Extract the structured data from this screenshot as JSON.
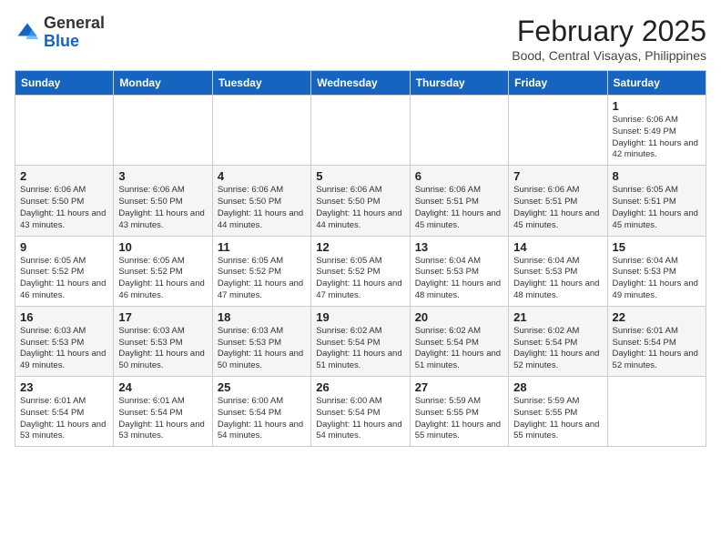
{
  "header": {
    "logo_general": "General",
    "logo_blue": "Blue",
    "month_year": "February 2025",
    "location": "Bood, Central Visayas, Philippines"
  },
  "weekdays": [
    "Sunday",
    "Monday",
    "Tuesday",
    "Wednesday",
    "Thursday",
    "Friday",
    "Saturday"
  ],
  "weeks": [
    [
      {
        "day": "",
        "info": ""
      },
      {
        "day": "",
        "info": ""
      },
      {
        "day": "",
        "info": ""
      },
      {
        "day": "",
        "info": ""
      },
      {
        "day": "",
        "info": ""
      },
      {
        "day": "",
        "info": ""
      },
      {
        "day": "1",
        "info": "Sunrise: 6:06 AM\nSunset: 5:49 PM\nDaylight: 11 hours and 42 minutes."
      }
    ],
    [
      {
        "day": "2",
        "info": "Sunrise: 6:06 AM\nSunset: 5:50 PM\nDaylight: 11 hours and 43 minutes."
      },
      {
        "day": "3",
        "info": "Sunrise: 6:06 AM\nSunset: 5:50 PM\nDaylight: 11 hours and 43 minutes."
      },
      {
        "day": "4",
        "info": "Sunrise: 6:06 AM\nSunset: 5:50 PM\nDaylight: 11 hours and 44 minutes."
      },
      {
        "day": "5",
        "info": "Sunrise: 6:06 AM\nSunset: 5:50 PM\nDaylight: 11 hours and 44 minutes."
      },
      {
        "day": "6",
        "info": "Sunrise: 6:06 AM\nSunset: 5:51 PM\nDaylight: 11 hours and 45 minutes."
      },
      {
        "day": "7",
        "info": "Sunrise: 6:06 AM\nSunset: 5:51 PM\nDaylight: 11 hours and 45 minutes."
      },
      {
        "day": "8",
        "info": "Sunrise: 6:05 AM\nSunset: 5:51 PM\nDaylight: 11 hours and 45 minutes."
      }
    ],
    [
      {
        "day": "9",
        "info": "Sunrise: 6:05 AM\nSunset: 5:52 PM\nDaylight: 11 hours and 46 minutes."
      },
      {
        "day": "10",
        "info": "Sunrise: 6:05 AM\nSunset: 5:52 PM\nDaylight: 11 hours and 46 minutes."
      },
      {
        "day": "11",
        "info": "Sunrise: 6:05 AM\nSunset: 5:52 PM\nDaylight: 11 hours and 47 minutes."
      },
      {
        "day": "12",
        "info": "Sunrise: 6:05 AM\nSunset: 5:52 PM\nDaylight: 11 hours and 47 minutes."
      },
      {
        "day": "13",
        "info": "Sunrise: 6:04 AM\nSunset: 5:53 PM\nDaylight: 11 hours and 48 minutes."
      },
      {
        "day": "14",
        "info": "Sunrise: 6:04 AM\nSunset: 5:53 PM\nDaylight: 11 hours and 48 minutes."
      },
      {
        "day": "15",
        "info": "Sunrise: 6:04 AM\nSunset: 5:53 PM\nDaylight: 11 hours and 49 minutes."
      }
    ],
    [
      {
        "day": "16",
        "info": "Sunrise: 6:03 AM\nSunset: 5:53 PM\nDaylight: 11 hours and 49 minutes."
      },
      {
        "day": "17",
        "info": "Sunrise: 6:03 AM\nSunset: 5:53 PM\nDaylight: 11 hours and 50 minutes."
      },
      {
        "day": "18",
        "info": "Sunrise: 6:03 AM\nSunset: 5:53 PM\nDaylight: 11 hours and 50 minutes."
      },
      {
        "day": "19",
        "info": "Sunrise: 6:02 AM\nSunset: 5:54 PM\nDaylight: 11 hours and 51 minutes."
      },
      {
        "day": "20",
        "info": "Sunrise: 6:02 AM\nSunset: 5:54 PM\nDaylight: 11 hours and 51 minutes."
      },
      {
        "day": "21",
        "info": "Sunrise: 6:02 AM\nSunset: 5:54 PM\nDaylight: 11 hours and 52 minutes."
      },
      {
        "day": "22",
        "info": "Sunrise: 6:01 AM\nSunset: 5:54 PM\nDaylight: 11 hours and 52 minutes."
      }
    ],
    [
      {
        "day": "23",
        "info": "Sunrise: 6:01 AM\nSunset: 5:54 PM\nDaylight: 11 hours and 53 minutes."
      },
      {
        "day": "24",
        "info": "Sunrise: 6:01 AM\nSunset: 5:54 PM\nDaylight: 11 hours and 53 minutes."
      },
      {
        "day": "25",
        "info": "Sunrise: 6:00 AM\nSunset: 5:54 PM\nDaylight: 11 hours and 54 minutes."
      },
      {
        "day": "26",
        "info": "Sunrise: 6:00 AM\nSunset: 5:54 PM\nDaylight: 11 hours and 54 minutes."
      },
      {
        "day": "27",
        "info": "Sunrise: 5:59 AM\nSunset: 5:55 PM\nDaylight: 11 hours and 55 minutes."
      },
      {
        "day": "28",
        "info": "Sunrise: 5:59 AM\nSunset: 5:55 PM\nDaylight: 11 hours and 55 minutes."
      },
      {
        "day": "",
        "info": ""
      }
    ]
  ]
}
